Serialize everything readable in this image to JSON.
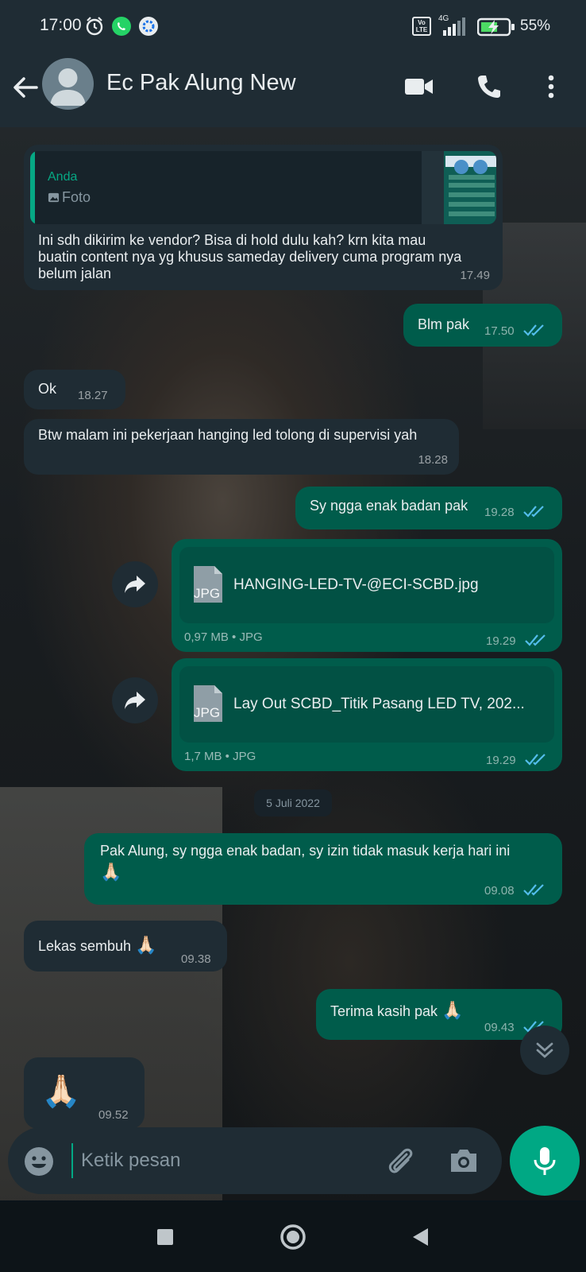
{
  "status_bar": {
    "time": "17:00",
    "network": "4G",
    "volte": "Vo LTE",
    "battery": "55%"
  },
  "header": {
    "title": "Ec Pak Alung New",
    "icons": [
      "back-arrow-icon",
      "avatar",
      "video-call-icon",
      "voice-call-icon",
      "more-options-icon"
    ]
  },
  "messages": [
    {
      "dir": "in",
      "quote_author": "Anda",
      "quote_type": "Foto",
      "text": "Ini sdh dikirim ke vendor?  Bisa di hold dulu kah?  krn kita mau buatin content nya yg khusus sameday delivery cuma program nya belum jalan",
      "time": "17.49"
    },
    {
      "dir": "out",
      "text": "Blm pak",
      "time": "17.50"
    },
    {
      "dir": "in",
      "text": "Ok",
      "time": "18.27"
    },
    {
      "dir": "in",
      "text": "Btw malam ini pekerjaan hanging led tolong di supervisi yah",
      "time": "18.28"
    },
    {
      "dir": "out",
      "text": "Sy ngga enak badan pak",
      "time": "19.28"
    },
    {
      "dir": "out",
      "type": "document",
      "file_label": "JPG",
      "file_name": "HANGING-LED-TV-@ECI-SCBD.jpg",
      "meta": "0,97 MB • JPG",
      "time": "19.29"
    },
    {
      "dir": "out",
      "type": "document",
      "file_label": "JPG",
      "file_name": "Lay Out SCBD_Titik Pasang LED TV, 202...",
      "meta": "1,7 MB • JPG",
      "time": "19.29"
    },
    {
      "dir": "out",
      "text": "Pak Alung,  sy ngga enak badan, sy izin tidak masuk kerja hari ini",
      "emoji": "🙏🏻",
      "time": "09.08"
    },
    {
      "dir": "in",
      "text": "Lekas sembuh",
      "emoji": "🙏🏻",
      "time": "09.38"
    },
    {
      "dir": "out",
      "text": "Terima kasih pak",
      "emoji": "🙏🏻",
      "time": "09.43"
    },
    {
      "dir": "in",
      "emoji": "🙏🏻",
      "time": "09.52"
    }
  ],
  "date_divider": "5 Juli 2022",
  "composer": {
    "placeholder": "Ketik pesan",
    "value": ""
  },
  "colors": {
    "header_bg": "#1f2c34",
    "incoming_bubble": "#1f2c34",
    "outgoing_bubble": "#005c4b",
    "accent": "#00a884",
    "read_ticks": "#53bdeb"
  }
}
